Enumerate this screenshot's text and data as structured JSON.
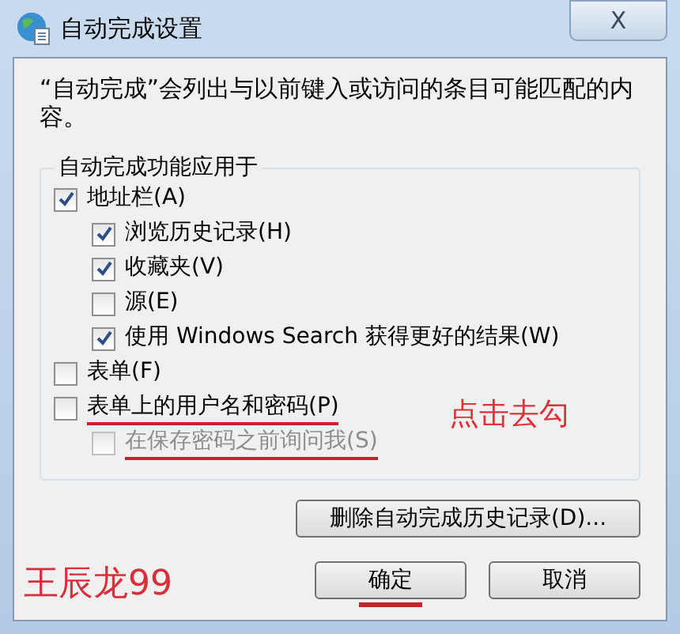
{
  "window": {
    "title": "自动完成设置",
    "close": "X"
  },
  "description": "“自动完成”会列出与以前键入或访问的条目可能匹配的内容。",
  "group": {
    "legend": "自动完成功能应用于",
    "items": [
      {
        "label": "地址栏(A)",
        "checked": true,
        "disabled": false,
        "underlined": false,
        "children": [
          {
            "label": "浏览历史记录(H)",
            "checked": true,
            "disabled": false,
            "underlined": false
          },
          {
            "label": "收藏夹(V)",
            "checked": true,
            "disabled": false,
            "underlined": false
          },
          {
            "label": "源(E)",
            "checked": false,
            "disabled": false,
            "underlined": false
          },
          {
            "label": "使用 Windows Search 获得更好的结果(W)",
            "checked": true,
            "disabled": false,
            "underlined": false
          }
        ]
      },
      {
        "label": "表单(F)",
        "checked": false,
        "disabled": false,
        "underlined": false
      },
      {
        "label": "表单上的用户名和密码(P)",
        "checked": false,
        "disabled": false,
        "underlined": true,
        "note": "点击去勾",
        "children": [
          {
            "label": "在保存密码之前询问我(S)",
            "checked": false,
            "disabled": true,
            "underlined": true
          }
        ]
      }
    ]
  },
  "delete_button": "删除自动完成历史记录(D)...",
  "signature": "王辰龙99",
  "buttons": [
    {
      "label": "确定",
      "underlined": true
    },
    {
      "label": "取消",
      "underlined": false
    }
  ]
}
